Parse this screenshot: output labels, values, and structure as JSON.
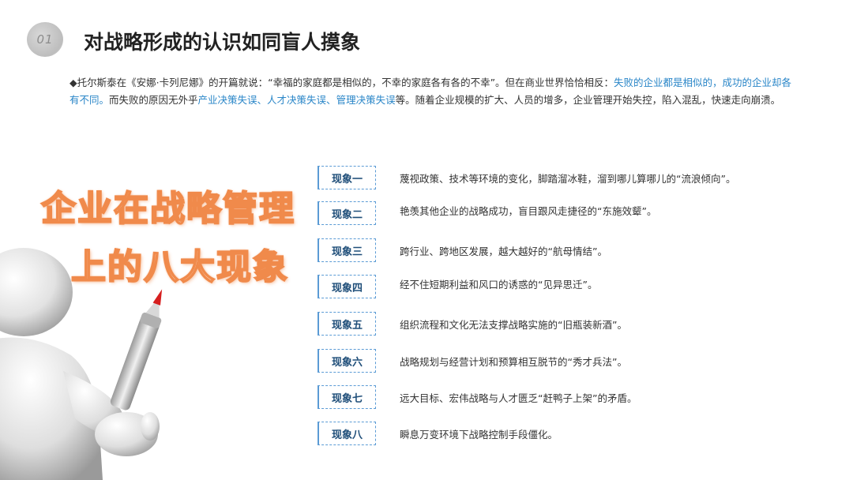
{
  "header": {
    "badge": "01",
    "title": "对战略形成的认识如同盲人摸象"
  },
  "intro": {
    "p1": "◆托尔斯泰在《安娜·卡列尼娜》的开篇就说：“幸福的家庭都是相似的，不幸的家庭各有各的不幸”。但在商业世界恰恰相反：",
    "p1_blue": "失败的企业都是相似的，成功的企业却各有不同。",
    "p2": "而失败的原因无外乎",
    "p2_blue1": "产业决策失误、",
    "p2_blue2": "人才决策失误、",
    "p2_blue3": "管理决策失误",
    "p3": "等。随着企业规模的扩大、人员的增多，企业管理开始失控，陷入混乱，快速走向崩溃。"
  },
  "headline": {
    "line1": "企业在战略管理",
    "line2": "上的八大现象"
  },
  "phenomena": [
    {
      "label": "现象一",
      "text": "蔑视政策、技术等环境的变化，脚踏溜冰鞋，溜到哪儿算哪儿的“流浪倾向”。"
    },
    {
      "label": "现象二",
      "text": "艳羡其他企业的战略成功，盲目跟风走捷径的“东施效颦”。"
    },
    {
      "label": "现象三",
      "text": "跨行业、跨地区发展，越大越好的“航母情结”。"
    },
    {
      "label": "现象四",
      "text": "经不住短期利益和风口的诱惑的“见异思迁”。"
    },
    {
      "label": "现象五",
      "text": "组织流程和文化无法支撑战略实施的“旧瓶装新酒”。"
    },
    {
      "label": "现象六",
      "text": "战略规划与经营计划和预算相互脱节的“秀才兵法”。"
    },
    {
      "label": "现象七",
      "text": "远大目标、宏伟战略与人才匮乏“赶鸭子上架”的矛盾。"
    },
    {
      "label": "现象八",
      "text": "瞬息万变环境下战略控制手段僵化。"
    }
  ]
}
